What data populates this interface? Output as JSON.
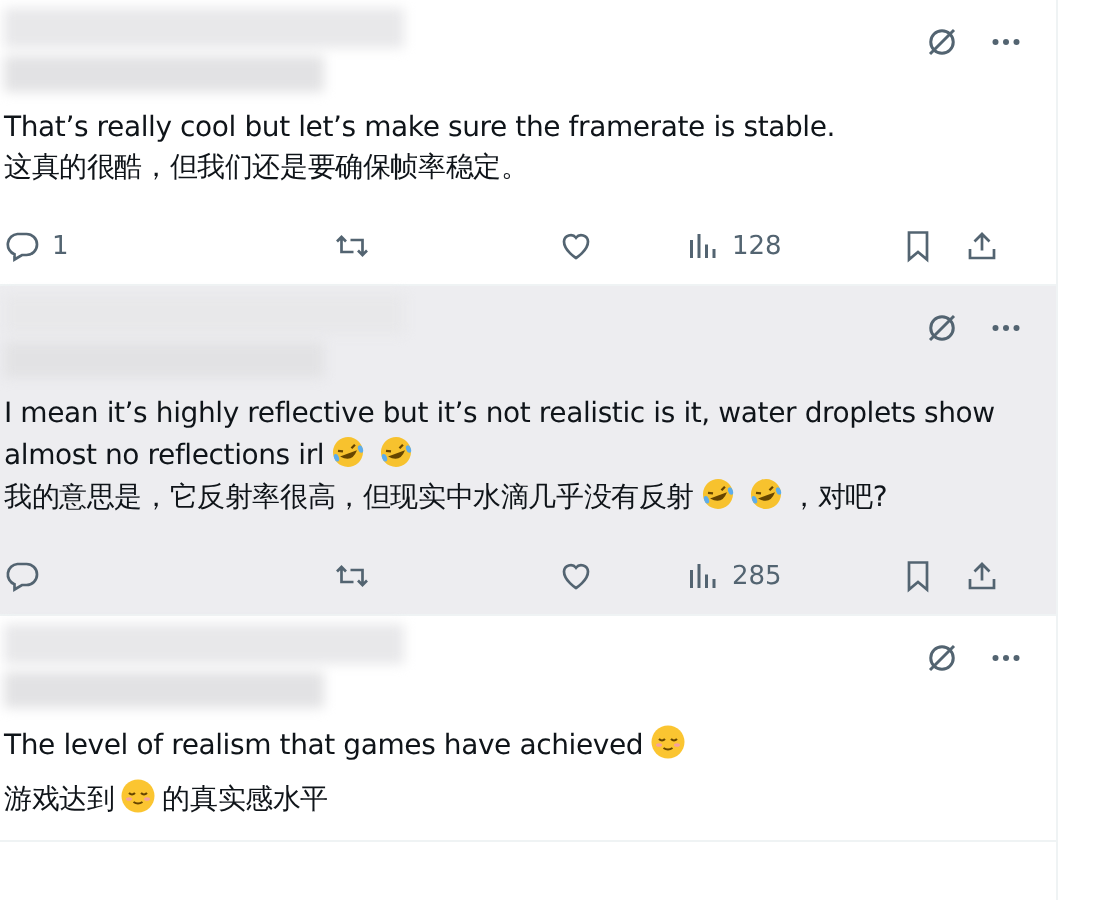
{
  "replies": [
    {
      "highlighted": false,
      "lines": [
        [
          {
            "kind": "text",
            "text": "That’s really cool but let’s make sure the framerate is stable."
          }
        ],
        [
          {
            "kind": "text",
            "text": "这真的很酷，但我们还是要确保帧率稳定。"
          }
        ]
      ],
      "actions": {
        "reply_count": "1",
        "views": "128"
      }
    },
    {
      "highlighted": true,
      "lines": [
        [
          {
            "kind": "text",
            "text": "I mean it’s highly reflective but it’s not realistic is it, water droplets show"
          }
        ],
        [
          {
            "kind": "text",
            "text": "almost no reflections irl"
          },
          {
            "kind": "rofl"
          },
          {
            "kind": "rofl"
          }
        ],
        [
          {
            "kind": "text",
            "text": "我的意思是，它反射率很高，但现实中水滴几乎没有反射"
          },
          {
            "kind": "rofl"
          },
          {
            "kind": "rofl"
          },
          {
            "kind": "text",
            "text": "，对吧?"
          }
        ]
      ],
      "actions": {
        "views": "285"
      }
    },
    {
      "highlighted": false,
      "lines": [
        [
          {
            "kind": "text",
            "text": "The level of realism that games have achieved"
          },
          {
            "kind": "relieved"
          }
        ],
        [
          {
            "kind": "text",
            "text": "游戏达到"
          },
          {
            "kind": "relieved"
          },
          {
            "kind": "text",
            "text": "的真实感水平"
          }
        ]
      ]
    }
  ]
}
